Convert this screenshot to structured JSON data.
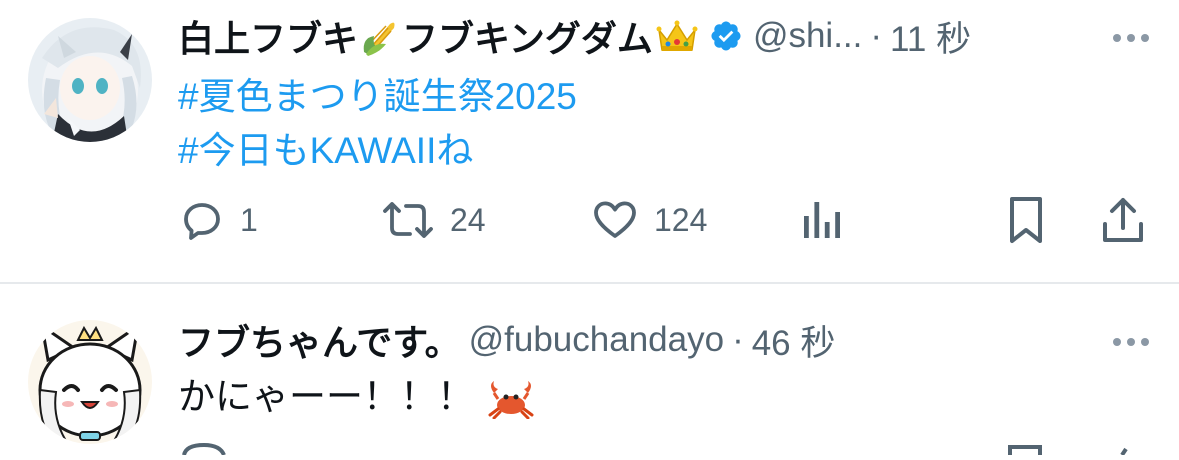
{
  "tweets": [
    {
      "display_name": "白上フブキ",
      "name_emoji_1": "corn-emoji",
      "display_name_2": "フブキングダム",
      "name_emoji_2": "crown-emoji",
      "verified": true,
      "handle": "@shi...",
      "dot": "·",
      "time": "11 秒",
      "hashtags": [
        "#夏色まつり誕生祭2025",
        "#今日もKAWAIIね"
      ],
      "actions": {
        "reply_count": "1",
        "retweet_count": "24",
        "like_count": "124"
      }
    },
    {
      "display_name": "フブちゃんです。",
      "handle": "@fubuchandayo",
      "dot": "·",
      "time": "46 秒",
      "text": "かにゃーー！！！",
      "text_emoji": "crab-emoji"
    }
  ],
  "colors": {
    "link": "#1d9bf0",
    "secondary_text": "#536471",
    "verified": "#1d9bf0",
    "divider": "#e6e9ec"
  }
}
